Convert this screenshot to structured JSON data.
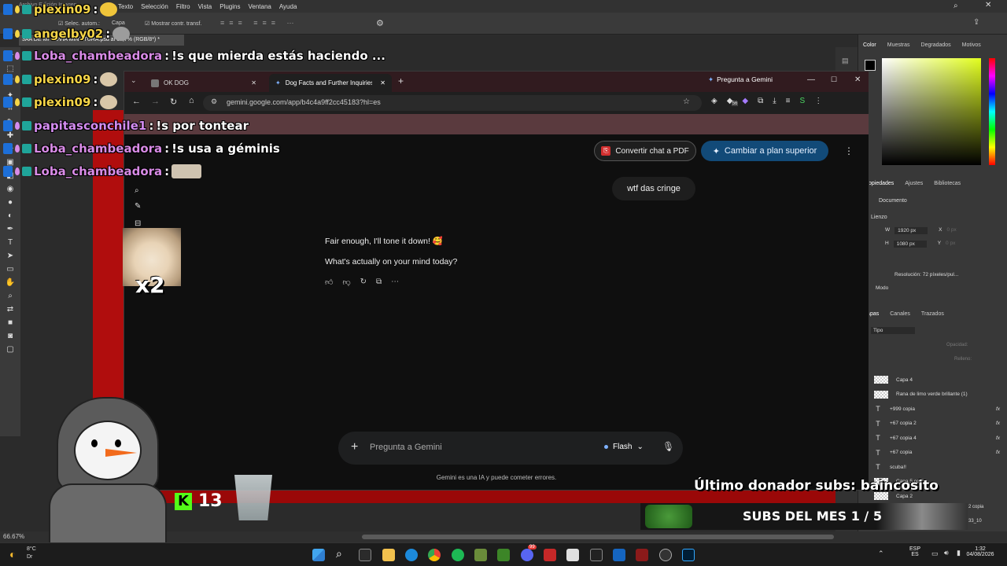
{
  "photoshop": {
    "menu": [
      "Texto",
      "Selección",
      "Filtro",
      "Vista",
      "Plugins",
      "Ventana",
      "Ayuda"
    ],
    "menu_partial": "Archivo  Edición  Imagen",
    "options": {
      "auto_select": "Selec. autom.:",
      "layer": "Capa",
      "show_transform": "Mostrar contr. transf."
    },
    "doc_tab": "3AA DE MI NOVIA MINIATURA.psd al 66,7% (RGB/8*) *",
    "panels": {
      "color_tabs": [
        "Color",
        "Muestras",
        "Degradados",
        "Motivos"
      ],
      "props_tabs": [
        "Propiedades",
        "Ajustes",
        "Bibliotecas"
      ],
      "document_label": "Documento",
      "canvas_label": "Lienzo",
      "width": "1920 px",
      "height": "1080 px",
      "x_placeholder": "0 px",
      "y_placeholder": "0 px",
      "resolution": "Resolución: 72 píxeles/pul...",
      "mode": "Modo",
      "layer_tabs": [
        "Capas",
        "Canales",
        "Trazados"
      ],
      "kind": "Tipo",
      "opacity": "Opacidad:",
      "fill": "Relleno:",
      "layers": [
        {
          "type": "img",
          "name": "Capa 4",
          "fx": ""
        },
        {
          "type": "img",
          "name": "Rana de limo verde brillante (1)",
          "fx": ""
        },
        {
          "type": "T",
          "name": "+999 copia",
          "fx": "fx"
        },
        {
          "type": "T",
          "name": "+67 copia 2",
          "fx": "fx"
        },
        {
          "type": "T",
          "name": "+67 copia 4",
          "fx": "fx"
        },
        {
          "type": "T",
          "name": "+67 copia",
          "fx": "fx"
        },
        {
          "type": "T",
          "name": "scuba!!",
          "fx": ""
        },
        {
          "type": "img",
          "name": "Capa 5 copia",
          "fx": ""
        },
        {
          "type": "img",
          "name": "Capa 2",
          "fx": ""
        }
      ],
      "layer_trailing": [
        "2 copia",
        "33_10"
      ]
    },
    "zoom": "66.67%"
  },
  "chrome": {
    "tabs": [
      {
        "title": "OK DOG",
        "active": false
      },
      {
        "title": "Dog Facts and Further Inquiries",
        "active": true
      }
    ],
    "new_tab": "+",
    "gemini_chip": "Pregunta a Gemini",
    "url": "gemini.google.com/app/b4c4a9ff2cc45183?hl=es",
    "extension_badge": "56"
  },
  "gemini": {
    "pdf_button": "Convertir chat a PDF",
    "upgrade_button": "Cambiar a plan superior",
    "user_message": "wtf das cringe",
    "response": [
      "Fair enough, I'll tone it down! 🥰",
      "What's actually on your mind today?"
    ],
    "prompt_placeholder": "Pregunta a Gemini",
    "model": "Flash",
    "disclaimer": "Gemini es una IA y puede cometer errores."
  },
  "chat": [
    {
      "user": "plexin09",
      "sep": ":",
      "message": "",
      "color": "#f5d547"
    },
    {
      "user": "angelby02",
      "sep": ":",
      "message": "",
      "color": "#f5d547"
    },
    {
      "user": "Loba_chambeadora",
      "sep": ":",
      "message": "!s que mierda estás haciendo ...",
      "color": "#d88be6"
    },
    {
      "user": "plexin09",
      "sep": ":",
      "message": "",
      "color": "#f5d547"
    },
    {
      "user": "plexin09",
      "sep": ":",
      "message": "",
      "color": "#f5d547"
    },
    {
      "user": "papitasconchile1",
      "sep": ":",
      "message": "!s por tontear",
      "color": "#d48cf0"
    },
    {
      "user": "Loba_chambeadora",
      "sep": ":",
      "message": "!s usa a géminis",
      "color": "#d88be6"
    },
    {
      "user": "Loba_chambeadora",
      "sep": ":",
      "message": "",
      "color": "#d88be6"
    }
  ],
  "overlay": {
    "emote_multiplier": "x2",
    "kick_letter": "K",
    "kick_count": "13",
    "last_donor": "Último donador subs: baincosito",
    "subs_month": "SUBS DEL MES 1 / 5"
  },
  "taskbar": {
    "weather_temp": "8°C",
    "weather_sub": "Dr",
    "lang": "ESP",
    "region": "ES",
    "time": "1:32",
    "date": "04/08/2026",
    "badges": {
      "discord": "99"
    }
  }
}
